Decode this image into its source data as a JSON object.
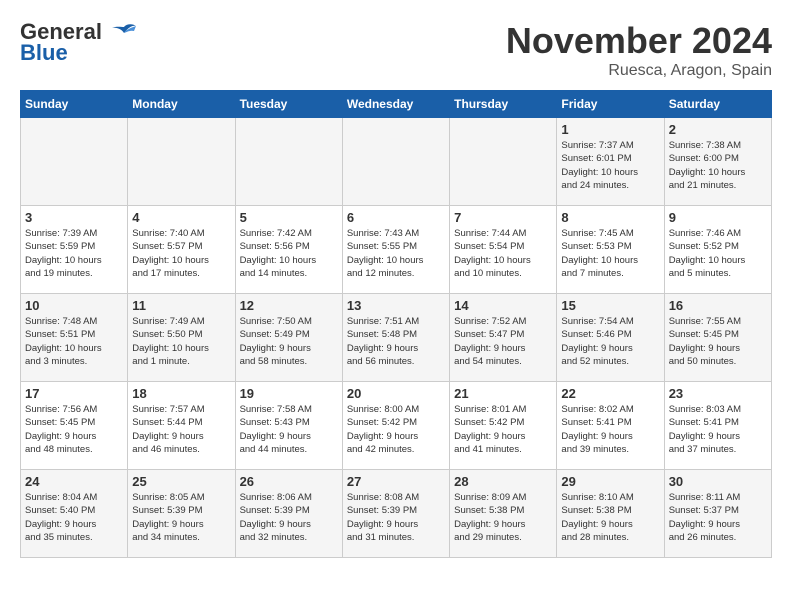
{
  "header": {
    "logo_line1": "General",
    "logo_line2": "Blue",
    "month": "November 2024",
    "location": "Ruesca, Aragon, Spain"
  },
  "weekdays": [
    "Sunday",
    "Monday",
    "Tuesday",
    "Wednesday",
    "Thursday",
    "Friday",
    "Saturday"
  ],
  "weeks": [
    [
      {
        "day": "",
        "info": ""
      },
      {
        "day": "",
        "info": ""
      },
      {
        "day": "",
        "info": ""
      },
      {
        "day": "",
        "info": ""
      },
      {
        "day": "",
        "info": ""
      },
      {
        "day": "1",
        "info": "Sunrise: 7:37 AM\nSunset: 6:01 PM\nDaylight: 10 hours\nand 24 minutes."
      },
      {
        "day": "2",
        "info": "Sunrise: 7:38 AM\nSunset: 6:00 PM\nDaylight: 10 hours\nand 21 minutes."
      }
    ],
    [
      {
        "day": "3",
        "info": "Sunrise: 7:39 AM\nSunset: 5:59 PM\nDaylight: 10 hours\nand 19 minutes."
      },
      {
        "day": "4",
        "info": "Sunrise: 7:40 AM\nSunset: 5:57 PM\nDaylight: 10 hours\nand 17 minutes."
      },
      {
        "day": "5",
        "info": "Sunrise: 7:42 AM\nSunset: 5:56 PM\nDaylight: 10 hours\nand 14 minutes."
      },
      {
        "day": "6",
        "info": "Sunrise: 7:43 AM\nSunset: 5:55 PM\nDaylight: 10 hours\nand 12 minutes."
      },
      {
        "day": "7",
        "info": "Sunrise: 7:44 AM\nSunset: 5:54 PM\nDaylight: 10 hours\nand 10 minutes."
      },
      {
        "day": "8",
        "info": "Sunrise: 7:45 AM\nSunset: 5:53 PM\nDaylight: 10 hours\nand 7 minutes."
      },
      {
        "day": "9",
        "info": "Sunrise: 7:46 AM\nSunset: 5:52 PM\nDaylight: 10 hours\nand 5 minutes."
      }
    ],
    [
      {
        "day": "10",
        "info": "Sunrise: 7:48 AM\nSunset: 5:51 PM\nDaylight: 10 hours\nand 3 minutes."
      },
      {
        "day": "11",
        "info": "Sunrise: 7:49 AM\nSunset: 5:50 PM\nDaylight: 10 hours\nand 1 minute."
      },
      {
        "day": "12",
        "info": "Sunrise: 7:50 AM\nSunset: 5:49 PM\nDaylight: 9 hours\nand 58 minutes."
      },
      {
        "day": "13",
        "info": "Sunrise: 7:51 AM\nSunset: 5:48 PM\nDaylight: 9 hours\nand 56 minutes."
      },
      {
        "day": "14",
        "info": "Sunrise: 7:52 AM\nSunset: 5:47 PM\nDaylight: 9 hours\nand 54 minutes."
      },
      {
        "day": "15",
        "info": "Sunrise: 7:54 AM\nSunset: 5:46 PM\nDaylight: 9 hours\nand 52 minutes."
      },
      {
        "day": "16",
        "info": "Sunrise: 7:55 AM\nSunset: 5:45 PM\nDaylight: 9 hours\nand 50 minutes."
      }
    ],
    [
      {
        "day": "17",
        "info": "Sunrise: 7:56 AM\nSunset: 5:45 PM\nDaylight: 9 hours\nand 48 minutes."
      },
      {
        "day": "18",
        "info": "Sunrise: 7:57 AM\nSunset: 5:44 PM\nDaylight: 9 hours\nand 46 minutes."
      },
      {
        "day": "19",
        "info": "Sunrise: 7:58 AM\nSunset: 5:43 PM\nDaylight: 9 hours\nand 44 minutes."
      },
      {
        "day": "20",
        "info": "Sunrise: 8:00 AM\nSunset: 5:42 PM\nDaylight: 9 hours\nand 42 minutes."
      },
      {
        "day": "21",
        "info": "Sunrise: 8:01 AM\nSunset: 5:42 PM\nDaylight: 9 hours\nand 41 minutes."
      },
      {
        "day": "22",
        "info": "Sunrise: 8:02 AM\nSunset: 5:41 PM\nDaylight: 9 hours\nand 39 minutes."
      },
      {
        "day": "23",
        "info": "Sunrise: 8:03 AM\nSunset: 5:41 PM\nDaylight: 9 hours\nand 37 minutes."
      }
    ],
    [
      {
        "day": "24",
        "info": "Sunrise: 8:04 AM\nSunset: 5:40 PM\nDaylight: 9 hours\nand 35 minutes."
      },
      {
        "day": "25",
        "info": "Sunrise: 8:05 AM\nSunset: 5:39 PM\nDaylight: 9 hours\nand 34 minutes."
      },
      {
        "day": "26",
        "info": "Sunrise: 8:06 AM\nSunset: 5:39 PM\nDaylight: 9 hours\nand 32 minutes."
      },
      {
        "day": "27",
        "info": "Sunrise: 8:08 AM\nSunset: 5:39 PM\nDaylight: 9 hours\nand 31 minutes."
      },
      {
        "day": "28",
        "info": "Sunrise: 8:09 AM\nSunset: 5:38 PM\nDaylight: 9 hours\nand 29 minutes."
      },
      {
        "day": "29",
        "info": "Sunrise: 8:10 AM\nSunset: 5:38 PM\nDaylight: 9 hours\nand 28 minutes."
      },
      {
        "day": "30",
        "info": "Sunrise: 8:11 AM\nSunset: 5:37 PM\nDaylight: 9 hours\nand 26 minutes."
      }
    ]
  ]
}
